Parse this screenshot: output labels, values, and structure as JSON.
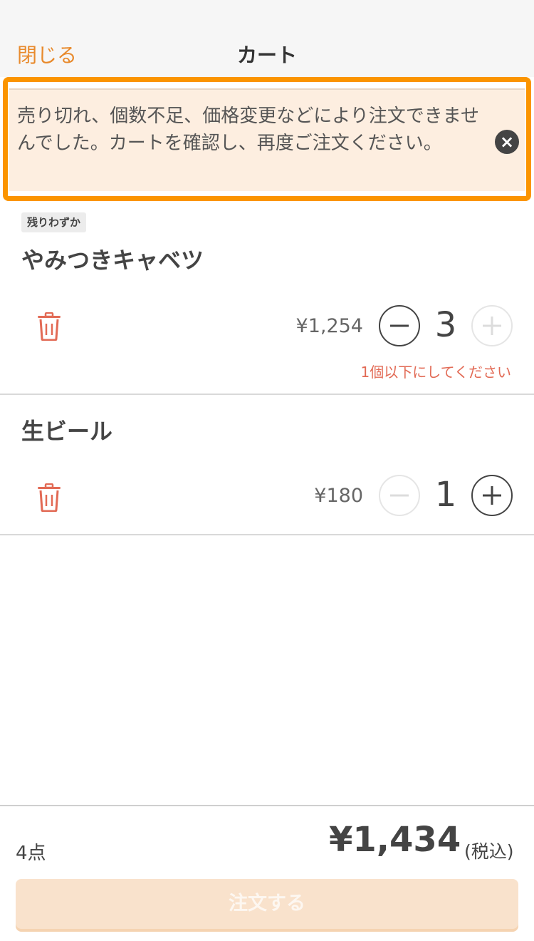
{
  "header": {
    "close_label": "閉じる",
    "title": "カート"
  },
  "alert": {
    "message": "売り切れ、個数不足、価格変更などにより注文できませんでした。カートを確認し、再度ご注文ください。",
    "close_icon": "×"
  },
  "items": [
    {
      "badge": "残りわずか",
      "name": "やみつきキャベツ",
      "price": "¥1,254",
      "quantity": "3",
      "minus_enabled": true,
      "plus_enabled": false,
      "warning": "1個以下にしてください"
    },
    {
      "name": "生ビール",
      "price": "¥180",
      "quantity": "1",
      "minus_enabled": false,
      "plus_enabled": true
    }
  ],
  "footer": {
    "count": "4点",
    "total": "¥1,434",
    "tax_note": "(税込)",
    "order_button": "注文する"
  },
  "colors": {
    "accent": "#e88a2c",
    "alert_border": "#fb9400",
    "alert_bg": "#fdeee0",
    "trash": "#e26a55",
    "warning": "#e26a55",
    "order_button_bg": "#f9e2cc"
  },
  "icons": [
    "close-icon",
    "trash-icon",
    "minus-icon",
    "plus-icon"
  ]
}
